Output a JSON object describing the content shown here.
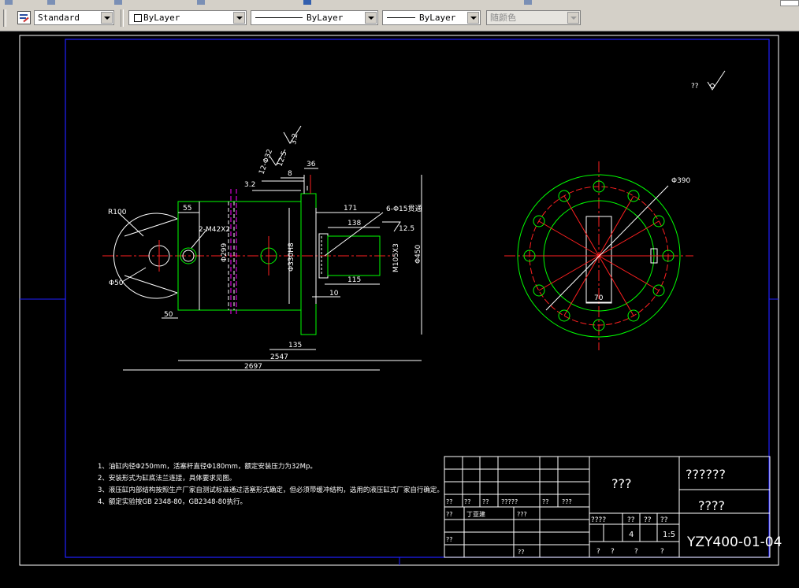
{
  "toolbar": {
    "style_label": "Standard",
    "color_label": "ByLayer",
    "linetype_label": "ByLayer",
    "lineweight_label": "ByLayer",
    "plotstyle_label": "随颜色"
  },
  "drawing": {
    "dimensions": {
      "r100": "R100",
      "d50_dia": "Φ50",
      "dim_55": "55",
      "m42": "2-M42X2",
      "dim_50": "50",
      "d299": "Φ299",
      "d330": "Φ330H8",
      "holes_12": "12-Φ32",
      "rough_125": "12.5",
      "rough_32": "3.2",
      "rough_32b": "3.2",
      "dim_8": "8",
      "dim_36": "36",
      "dim_171": "171",
      "dim_138": "138",
      "holes_6": "6-Φ15贯通",
      "rough_125b": "12.5",
      "m105": "M105X3",
      "d450": "Φ450",
      "dim_115": "115",
      "dim_10": "10",
      "dim_135": "135",
      "dim_2547": "2547",
      "dim_2697": "2697",
      "d390": "Φ390",
      "dim_70": "70",
      "corner_mark": "??"
    },
    "notes": [
      "1、油缸内径Φ250mm，活塞杆直径Φ180mm，额定安装压力为32Mp。",
      "2、安装形式为缸底法兰连接，具体要求见图。",
      "3、液压缸内部结构按照生产厂家自测试标准通过活塞形式确定，但必须带缓冲结构，选用的液压缸式厂家自行确定。",
      "4、额定实验按GB 2348-80，GB2348-80执行。"
    ],
    "title_block": {
      "name": "???",
      "company": "??????",
      "material": "????",
      "drawing_no": "YZY400-01-04",
      "qty": "4",
      "scale": "1:5",
      "h1": "??",
      "h2": "??",
      "h3": "??",
      "h4": "?????",
      "h5": "??",
      "h6": "???",
      "design_label": "??",
      "designer": "丁亚建",
      "design_date": "???",
      "check_label": "??",
      "approve_label": "??",
      "stage_label": "????",
      "col_a": "??",
      "col_b": "??",
      "col_c": "??",
      "q1": "?",
      "q2": "?",
      "q3": "?",
      "q4": "?"
    }
  }
}
